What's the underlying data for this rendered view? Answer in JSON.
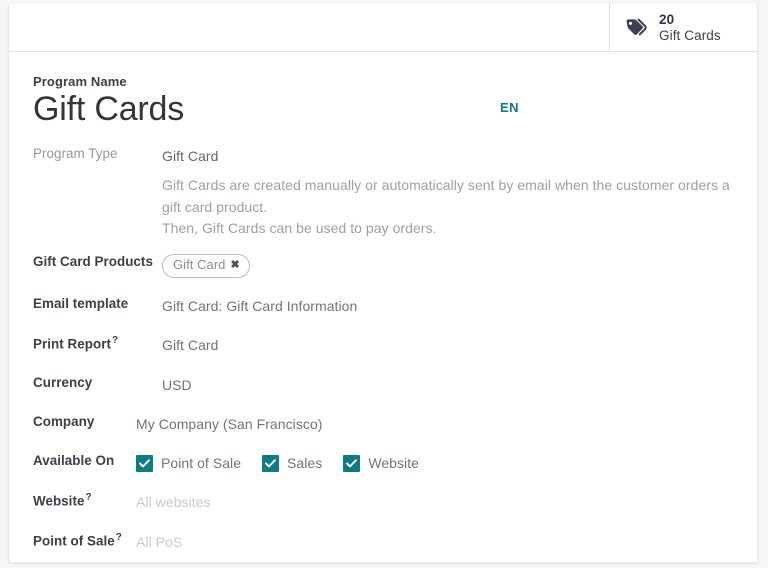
{
  "header": {
    "stat": {
      "icon": "tags-icon",
      "value": "20",
      "label": "Gift Cards"
    }
  },
  "form": {
    "title_label": "Program Name",
    "title_value": "Gift Cards",
    "language_badge": "EN",
    "fields": {
      "program_type": {
        "label": "Program Type",
        "value": "Gift Card",
        "description_line1": "Gift Cards are created manually or automatically sent by email when the customer orders a gift card product.",
        "description_line2": "Then, Gift Cards can be used to pay orders."
      },
      "gift_card_products": {
        "label": "Gift Card Products",
        "tag": "Gift Card",
        "tag_remove": "✖"
      },
      "email_template": {
        "label": "Email template",
        "value": "Gift Card: Gift Card Information"
      },
      "print_report": {
        "label": "Print Report",
        "help": "?",
        "value": "Gift Card"
      },
      "currency": {
        "label": "Currency",
        "value": "USD"
      },
      "company": {
        "label": "Company",
        "value": "My Company (San Francisco)"
      },
      "available_on": {
        "label": "Available On",
        "options": [
          {
            "label": "Point of Sale",
            "checked": true
          },
          {
            "label": "Sales",
            "checked": true
          },
          {
            "label": "Website",
            "checked": true
          }
        ]
      },
      "website": {
        "label": "Website",
        "help": "?",
        "placeholder": "All websites"
      },
      "point_of_sale": {
        "label": "Point of Sale",
        "help": "?",
        "placeholder": "All PoS"
      }
    }
  },
  "colors": {
    "accent": "#0f7c83",
    "link": "#0e7c8c",
    "label": "#3c3f49",
    "value": "#6f7481",
    "placeholder": "#c6c9d2"
  }
}
